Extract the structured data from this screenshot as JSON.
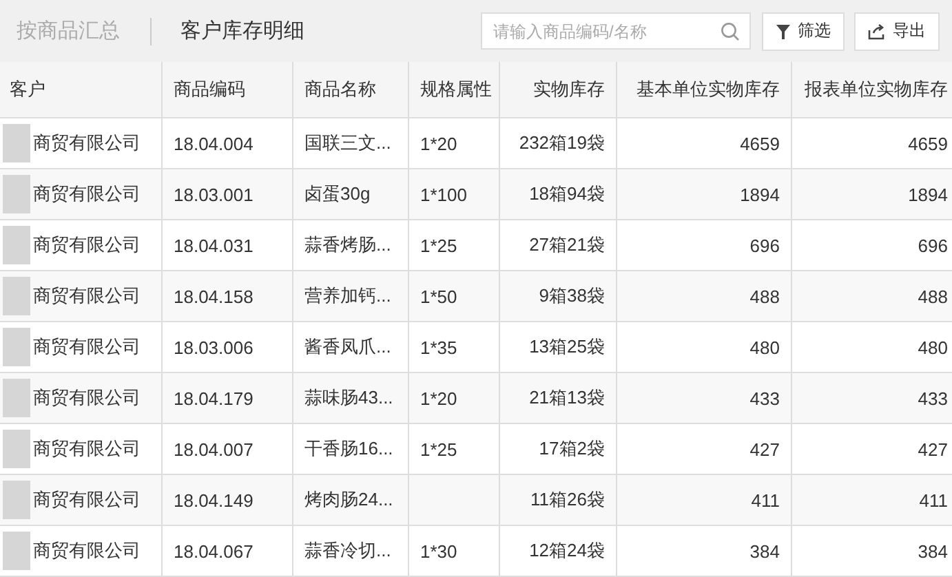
{
  "tabs": [
    {
      "label": "按商品汇总",
      "selected": false
    },
    {
      "label": "客户库存明细",
      "selected": true
    }
  ],
  "search": {
    "placeholder": "请输入商品编码/名称"
  },
  "buttons": [
    {
      "kind": "filter",
      "label": "筛选"
    },
    {
      "kind": "export",
      "label": "导出"
    }
  ],
  "table": {
    "columns": [
      "客户",
      "商品编码",
      "商品名称",
      "规格属性",
      "实物库存",
      "基本单位实物库存",
      "报表单位实物库存"
    ],
    "rows": [
      {
        "cells": [
          "商贸有限公司",
          "18.04.004",
          "国联三文...",
          "1*20",
          "232箱19袋",
          "4659",
          "4659"
        ]
      },
      {
        "cells": [
          "商贸有限公司",
          "18.03.001",
          "卤蛋30g",
          "1*100",
          "18箱94袋",
          "1894",
          "1894"
        ]
      },
      {
        "cells": [
          "商贸有限公司",
          "18.04.031",
          "蒜香烤肠...",
          "1*25",
          "27箱21袋",
          "696",
          "696"
        ]
      },
      {
        "cells": [
          "商贸有限公司",
          "18.04.158",
          "营养加钙...",
          "1*50",
          "9箱38袋",
          "488",
          "488"
        ]
      },
      {
        "cells": [
          "商贸有限公司",
          "18.03.006",
          "酱香凤爪...",
          "1*35",
          "13箱25袋",
          "480",
          "480"
        ]
      },
      {
        "cells": [
          "商贸有限公司",
          "18.04.179",
          "蒜味肠43...",
          "1*20",
          "21箱13袋",
          "433",
          "433"
        ]
      },
      {
        "cells": [
          "商贸有限公司",
          "18.04.007",
          "干香肠16...",
          "1*25",
          "17箱2袋",
          "427",
          "427"
        ]
      },
      {
        "cells": [
          "商贸有限公司",
          "18.04.149",
          "烤肉肠24...",
          "",
          "11箱26袋",
          "411",
          "411"
        ]
      },
      {
        "cells": [
          "商贸有限公司",
          "18.04.067",
          "蒜香冷切...",
          "1*30",
          "12箱24袋",
          "384",
          "384"
        ]
      }
    ]
  }
}
